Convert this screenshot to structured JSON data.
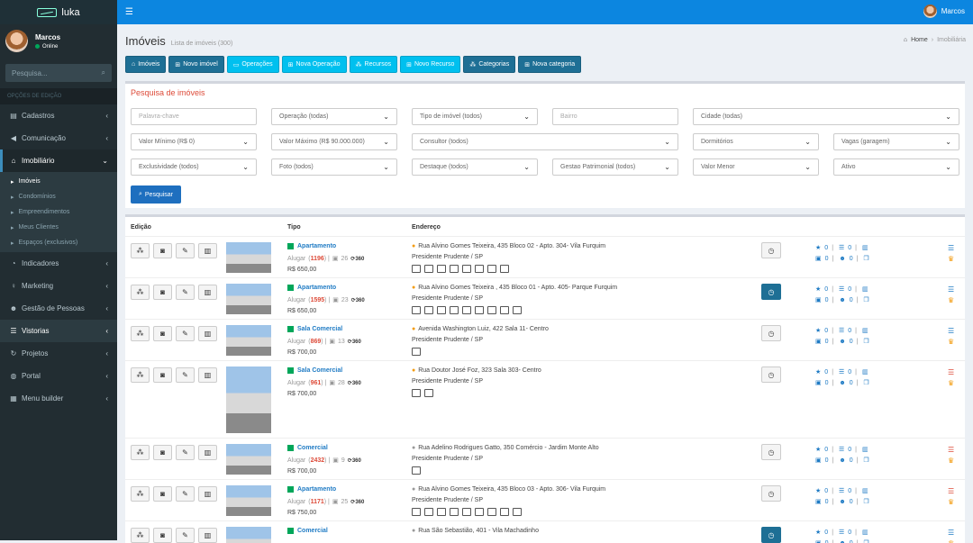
{
  "app": {
    "name": "luka"
  },
  "user": {
    "name": "Marcos",
    "status": "Online"
  },
  "sidebar": {
    "search_placeholder": "Pesquisa...",
    "section_label": "OPÇÕES DE EDIÇÃO",
    "items": [
      {
        "label": "Cadastros",
        "icon": "database-icon"
      },
      {
        "label": "Comunicação",
        "icon": "bullhorn-icon"
      },
      {
        "label": "Imobiliário",
        "icon": "home-icon"
      },
      {
        "label": "Indicadores",
        "icon": "pie-chart-icon"
      },
      {
        "label": "Marketing",
        "icon": "lightbulb-icon"
      },
      {
        "label": "Gestão de Pessoas",
        "icon": "users-icon"
      },
      {
        "label": "Vistorias",
        "icon": "list-icon"
      },
      {
        "label": "Projetos",
        "icon": "refresh-icon"
      },
      {
        "label": "Portal",
        "icon": "globe-icon"
      },
      {
        "label": "Menu builder",
        "icon": "list-alt-icon"
      }
    ],
    "subitems": [
      "Imóveis",
      "Condomínios",
      "Empreendimentos",
      "Meus Clientes",
      "Espaços (exclusivos)"
    ]
  },
  "page": {
    "title": "Imóveis",
    "subtitle": "Lista de imóveis (300)",
    "breadcrumb": {
      "home": "Home",
      "current": "Imobiliária"
    }
  },
  "toolbar": [
    {
      "label": "Imóveis",
      "style": "dark"
    },
    {
      "label": "Novo imóvel",
      "style": "dark"
    },
    {
      "label": "Operações",
      "style": "cyan"
    },
    {
      "label": "Nova Operação",
      "style": "cyan"
    },
    {
      "label": "Recursos",
      "style": "cyan"
    },
    {
      "label": "Novo Recurso",
      "style": "cyan"
    },
    {
      "label": "Categorias",
      "style": "dark"
    },
    {
      "label": "Nova categoria",
      "style": "dark"
    }
  ],
  "search": {
    "title": "Pesquisa de imóveis",
    "fields": {
      "keyword": "Palavra-chave",
      "operation": "Operação (todas)",
      "type": "Tipo de imóvel (todos)",
      "neighborhood": "Bairro",
      "city": "Cidade (todas)",
      "min_value": "Valor Mínimo (R$ 0)",
      "max_value": "Valor Máximo (R$ 90.000.000)",
      "consultant": "Consultor (todos)",
      "bedrooms": "Dormitórios",
      "parking": "Vagas (garagem)",
      "exclusivity": "Exclusividade (todos)",
      "photo": "Foto (todos)",
      "highlight": "Destaque (todos)",
      "asset_mgmt": "Gestao Patrimonial (todos)",
      "order": "Valor Menor",
      "status": "Ativo"
    },
    "button": "Pesquisar"
  },
  "table": {
    "headers": {
      "edit": "Edição",
      "type": "Tipo",
      "address": "Endereço"
    },
    "rows": [
      {
        "type": "Apartamento",
        "op": "Alugar",
        "code": "1196",
        "photos": "26",
        "price": "R$ 650,00",
        "address": "Rua Alvino Gomes Teixeira, 435 Bloco 02 - Apto. 304- Vila Furquim",
        "city": "Presidente Prudente / SP",
        "icons": 8,
        "clock": "gray",
        "rt": "blue"
      },
      {
        "type": "Apartamento",
        "op": "Alugar",
        "code": "1595",
        "photos": "23",
        "price": "R$ 650,00",
        "address": "Rua Alvino Gomes Teixeira , 435 Bloco 01 - Apto. 405- Parque Furquim",
        "city": "Presidente Prudente / SP",
        "icons": 9,
        "clock": "blue",
        "rt": "blue"
      },
      {
        "type": "Sala Comercial",
        "op": "Alugar",
        "code": "869",
        "photos": "13",
        "price": "R$ 700,00",
        "address": "Avenida Washington Luiz, 422 Sala 11- Centro",
        "city": "Presidente Prudente / SP",
        "icons": 1,
        "clock": "gray",
        "rt": "blue"
      },
      {
        "type": "Sala Comercial",
        "op": "Alugar",
        "code": "961",
        "photos": "28",
        "price": "R$ 700,00",
        "address": "Rua Doutor José Foz, 323 Sala 303- Centro",
        "city": "Presidente Prudente / SP",
        "icons": 2,
        "clock": "gray",
        "rt": "red"
      },
      {
        "type": "Comercial",
        "op": "Alugar",
        "code": "2432",
        "photos": "9",
        "price": "R$ 700,00",
        "address": "Rua Adelino Rodrigues Gatto, 350 Comércio - Jardim Monte Alto",
        "city": "Presidente Prudente / SP",
        "icons": 1,
        "clock": "gray",
        "rt": "red"
      },
      {
        "type": "Apartamento",
        "op": "Alugar",
        "code": "1171",
        "photos": "25",
        "price": "R$ 750,00",
        "address": "Rua Alvino Gomes Teixeira, 435 Bloco 03 - Apto. 306- Vila Furquim",
        "city": "Presidente Prudente / SP",
        "icons": 9,
        "clock": "gray",
        "rt": "red"
      },
      {
        "type": "Comercial",
        "op": "",
        "code": "",
        "photos": "",
        "price": "",
        "address": "Rua São Sebastião, 401 - Vila Machadinho",
        "city": "",
        "icons": 0,
        "clock": "blue",
        "rt": "blue"
      }
    ],
    "stat_zero": "0"
  }
}
